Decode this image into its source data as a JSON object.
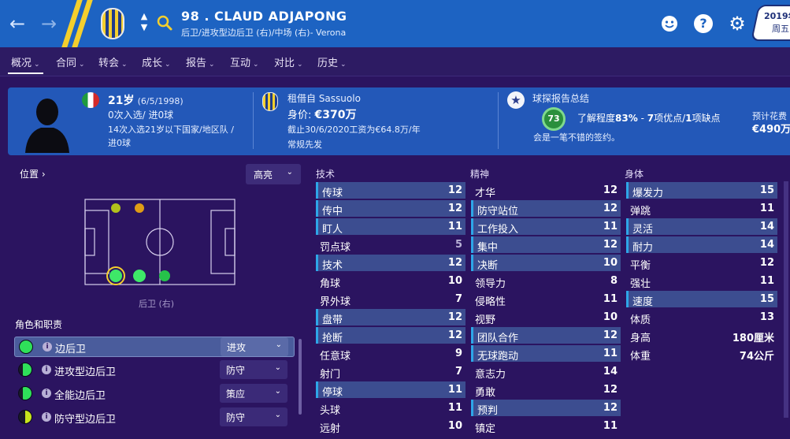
{
  "header": {
    "player_name": "98 . CLAUD ADJAPONG",
    "player_subtitle": "后卫/进攻型边后卫 (右)/中场 (右)- Verona",
    "date_year": "2019年",
    "date_day": "周五"
  },
  "tabs": [
    {
      "label": "概况",
      "active": true
    },
    {
      "label": "合同",
      "active": false
    },
    {
      "label": "转会",
      "active": false
    },
    {
      "label": "成长",
      "active": false
    },
    {
      "label": "报告",
      "active": false
    },
    {
      "label": "互动",
      "active": false
    },
    {
      "label": "对比",
      "active": false
    },
    {
      "label": "历史",
      "active": false
    }
  ],
  "info": {
    "age_main": "21岁",
    "age_dob": "(6/5/1998)",
    "caps_line": "0次入选/ 进0球",
    "u21_line1": "14次入选21岁以下国家/地区队 /",
    "u21_line2": "进0球",
    "loan_from": "租借自 Sassuolo",
    "value_label": "身价: ",
    "value_amount": "€370万",
    "wage_line": "截止30/6/2020工资为€64.8万/年",
    "status_line": "常规先发",
    "scout_title": "球探报告总结",
    "scout_rating": "73",
    "scout_knowledge_pre": "了解程度",
    "scout_knowledge_pct": "83%",
    "scout_pros_sep": " - ",
    "scout_pros": "7",
    "scout_pros_label": "项优点/",
    "scout_cons": "1",
    "scout_cons_label": "项缺点",
    "scout_verdict": "会是一笔不错的签约。",
    "fee_label": "预计花费",
    "fee_value": "€490万"
  },
  "position": {
    "title": "位置",
    "highlight_label": "高亮",
    "current_position": "后卫 (右)"
  },
  "roles": {
    "title": "角色和职责",
    "items": [
      {
        "name": "边后卫",
        "duty": "进攻",
        "fill": "full",
        "selected": true
      },
      {
        "name": "进攻型边后卫",
        "duty": "防守",
        "fill": "three-quarter",
        "selected": false
      },
      {
        "name": "全能边后卫",
        "duty": "策应",
        "fill": "three-quarter",
        "selected": false
      },
      {
        "name": "防守型边后卫",
        "duty": "防守",
        "fill": "half",
        "selected": false
      }
    ]
  },
  "technical": {
    "title": "技术",
    "attrs": [
      {
        "name": "传球",
        "value": "12",
        "hi": true
      },
      {
        "name": "传中",
        "value": "12",
        "hi": true
      },
      {
        "name": "盯人",
        "value": "11",
        "hi": true
      },
      {
        "name": "罚点球",
        "value": "5",
        "hi": false
      },
      {
        "name": "技术",
        "value": "12",
        "hi": true
      },
      {
        "name": "角球",
        "value": "10",
        "hi": false
      },
      {
        "name": "界外球",
        "value": "7",
        "hi": false
      },
      {
        "name": "盘带",
        "value": "12",
        "hi": true
      },
      {
        "name": "抢断",
        "value": "12",
        "hi": true
      },
      {
        "name": "任意球",
        "value": "9",
        "hi": false
      },
      {
        "name": "射门",
        "value": "7",
        "hi": false
      },
      {
        "name": "停球",
        "value": "11",
        "hi": true
      },
      {
        "name": "头球",
        "value": "11",
        "hi": false
      },
      {
        "name": "远射",
        "value": "10",
        "hi": false
      }
    ]
  },
  "mental": {
    "title": "精神",
    "attrs": [
      {
        "name": "才华",
        "value": "12",
        "hi": false
      },
      {
        "name": "防守站位",
        "value": "12",
        "hi": true
      },
      {
        "name": "工作投入",
        "value": "11",
        "hi": true
      },
      {
        "name": "集中",
        "value": "12",
        "hi": true
      },
      {
        "name": "决断",
        "value": "10",
        "hi": true
      },
      {
        "name": "领导力",
        "value": "8",
        "hi": false
      },
      {
        "name": "侵略性",
        "value": "11",
        "hi": false
      },
      {
        "name": "视野",
        "value": "10",
        "hi": false
      },
      {
        "name": "团队合作",
        "value": "12",
        "hi": true
      },
      {
        "name": "无球跑动",
        "value": "11",
        "hi": true
      },
      {
        "name": "意志力",
        "value": "14",
        "hi": false
      },
      {
        "name": "勇敢",
        "value": "12",
        "hi": false
      },
      {
        "name": "预判",
        "value": "12",
        "hi": true
      },
      {
        "name": "镇定",
        "value": "11",
        "hi": false
      }
    ]
  },
  "physical": {
    "title": "身体",
    "attrs": [
      {
        "name": "爆发力",
        "value": "15",
        "hi": true
      },
      {
        "name": "弹跳",
        "value": "11",
        "hi": false
      },
      {
        "name": "灵活",
        "value": "14",
        "hi": true
      },
      {
        "name": "耐力",
        "value": "14",
        "hi": true
      },
      {
        "name": "平衡",
        "value": "12",
        "hi": false
      },
      {
        "name": "强壮",
        "value": "11",
        "hi": false
      },
      {
        "name": "速度",
        "value": "15",
        "hi": true
      },
      {
        "name": "体质",
        "value": "13",
        "hi": false
      },
      {
        "name": "身高",
        "value": "180厘米",
        "hi": false
      },
      {
        "name": "体重",
        "value": "74公斤",
        "hi": false
      }
    ]
  },
  "colors": {
    "header_blue": "#1d63c2",
    "accent_yellow": "#f4cf2d",
    "background_purple": "#2b1460",
    "info_blue": "#2358b8",
    "highlight_row": "#3c4d90",
    "role_green": "#2fe05a"
  }
}
